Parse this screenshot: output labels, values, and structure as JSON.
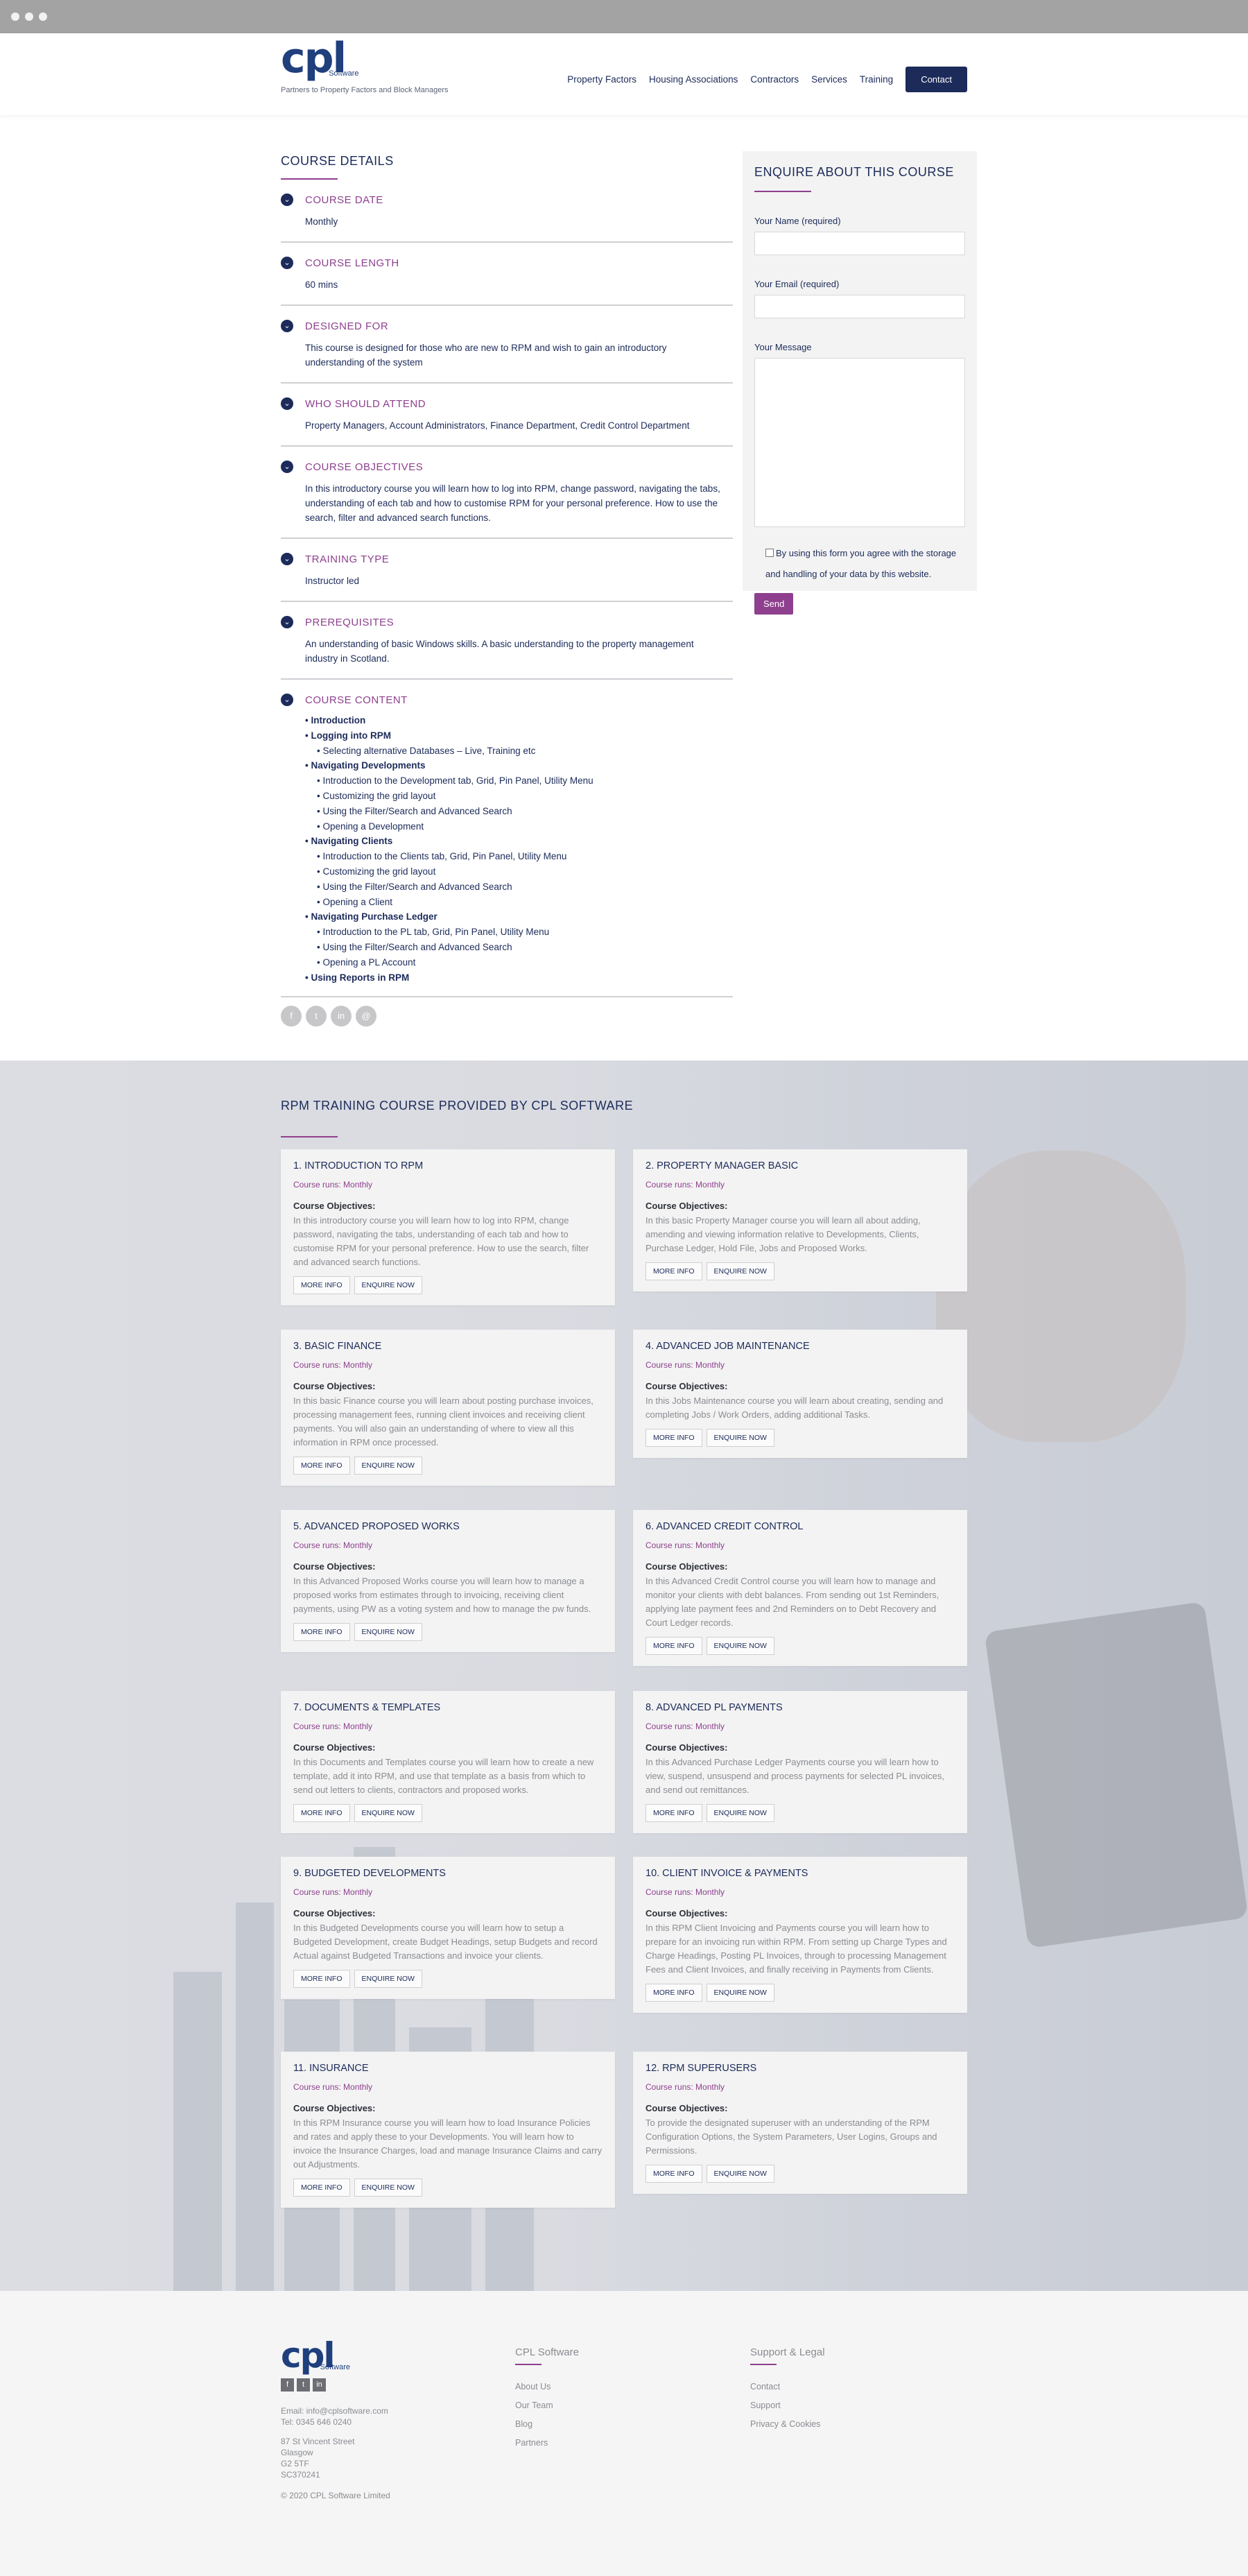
{
  "brand": {
    "logo_text": "cpl",
    "logo_sub": "Software",
    "tagline": "Partners to Property Factors and Block Managers"
  },
  "nav": {
    "items": [
      "Property Factors",
      "Housing Associations",
      "Contractors",
      "Services",
      "Training"
    ],
    "contact": "Contact"
  },
  "course_details": {
    "title": "COURSE DETAILS",
    "sections": [
      {
        "title": "COURSE DATE",
        "body": "Monthly"
      },
      {
        "title": "COURSE LENGTH",
        "body": "60 mins"
      },
      {
        "title": "DESIGNED FOR",
        "body": "This course is designed for those who are new to RPM and wish to gain an introductory understanding of the system"
      },
      {
        "title": "WHO SHOULD ATTEND",
        "body": "Property Managers, Account Administrators, Finance Department, Credit Control Department"
      },
      {
        "title": "COURSE OBJECTIVES",
        "body": "In this introductory course you will learn how to log into RPM, change password, navigating the tabs, understanding of each tab and how to customise RPM for your personal preference. How to use the search, filter and advanced search functions."
      },
      {
        "title": "TRAINING TYPE",
        "body": "Instructor led"
      },
      {
        "title": "PREREQUISITES",
        "body": "An understanding of basic Windows skills. A basic understanding to the property management industry in Scotland."
      },
      {
        "title": "COURSE CONTENT"
      }
    ],
    "content_items": [
      {
        "text": "Introduction",
        "level": 0
      },
      {
        "text": "Logging into RPM",
        "level": 0
      },
      {
        "text": "Selecting alternative Databases – Live, Training etc",
        "level": 1
      },
      {
        "text": "Navigating Developments",
        "level": 0
      },
      {
        "text": "Introduction to the Development tab, Grid, Pin Panel, Utility Menu",
        "level": 1
      },
      {
        "text": "Customizing the grid layout",
        "level": 1
      },
      {
        "text": "Using the Filter/Search and Advanced Search",
        "level": 1
      },
      {
        "text": "Opening a Development",
        "level": 1
      },
      {
        "text": "Navigating Clients",
        "level": 0
      },
      {
        "text": "Introduction to the Clients tab, Grid, Pin Panel, Utility Menu",
        "level": 1
      },
      {
        "text": "Customizing the grid layout",
        "level": 1
      },
      {
        "text": "Using the Filter/Search and Advanced Search",
        "level": 1
      },
      {
        "text": "Opening a Client",
        "level": 1
      },
      {
        "text": "Navigating Purchase Ledger",
        "level": 0
      },
      {
        "text": "Introduction to the PL tab, Grid, Pin Panel, Utility Menu",
        "level": 1
      },
      {
        "text": "Using the Filter/Search and Advanced Search",
        "level": 1
      },
      {
        "text": "Opening a PL Account",
        "level": 1
      },
      {
        "text": "Using Reports in RPM",
        "level": 0
      }
    ],
    "share_icons": [
      "f",
      "t",
      "in",
      "@"
    ]
  },
  "enquire": {
    "title": "ENQUIRE ABOUT THIS COURSE",
    "name_label": "Your Name (required)",
    "email_label": "Your Email (required)",
    "message_label": "Your Message",
    "consent": "By using this form you agree with the storage and handling of your data by this website.",
    "send": "Send"
  },
  "training": {
    "title": "RPM TRAINING COURSE PROVIDED BY CPL SOFTWARE",
    "runs_label": "Course runs: Monthly",
    "objectives_label": "Course Objectives:",
    "more_info": "MORE INFO",
    "enquire_now": "ENQUIRE NOW",
    "courses": [
      {
        "title": "1. INTRODUCTION TO RPM",
        "text": "In this introductory course you will learn how to log into RPM, change password, navigating the tabs, understanding of each tab and how to customise RPM for your personal preference. How to use the search, filter and advanced search functions."
      },
      {
        "title": "2. PROPERTY MANAGER BASIC",
        "text": "In this basic Property Manager course you will learn all about adding, amending and viewing information relative to Developments, Clients, Purchase Ledger, Hold File, Jobs and Proposed Works."
      },
      {
        "title": "3. BASIC FINANCE",
        "text": "In this basic Finance course you will learn about posting purchase invoices, processing management fees, running client invoices and receiving client payments. You will also gain an understanding of where to view all this information in RPM once processed."
      },
      {
        "title": "4. ADVANCED JOB MAINTENANCE",
        "text": "In this Jobs Maintenance course you will learn about creating, sending and completing Jobs / Work Orders, adding additional Tasks."
      },
      {
        "title": "5. ADVANCED PROPOSED WORKS",
        "text": "In this Advanced Proposed Works course you will learn how to manage a proposed works from estimates through to invoicing, receiving client payments, using PW as a voting system and how to manage the pw funds."
      },
      {
        "title": "6. ADVANCED CREDIT CONTROL",
        "text": "In this Advanced Credit Control course you will learn how to manage and monitor your clients with debt balances. From sending out 1st Reminders, applying late payment fees and 2nd Reminders on to Debt Recovery and Court Ledger records."
      },
      {
        "title": "7. DOCUMENTS & TEMPLATES",
        "text": "In this Documents and Templates course you will learn how to create a new template, add it into RPM, and use that template as a basis from which to send out letters to clients, contractors and proposed works."
      },
      {
        "title": "8. ADVANCED PL PAYMENTS",
        "text": "In this Advanced Purchase Ledger Payments course you will learn how to view, suspend, unsuspend and process payments for selected PL invoices, and send out remittances."
      },
      {
        "title": "9. BUDGETED DEVELOPMENTS",
        "text": "In this Budgeted Developments course you will learn how to setup a Budgeted Development, create Budget Headings, setup Budgets and record Actual against Budgeted Transactions and invoice your clients."
      },
      {
        "title": "10. CLIENT INVOICE & PAYMENTS",
        "text": "In this RPM Client Invoicing and Payments course you will learn how to prepare for an invoicing run within RPM. From setting up Charge Types and Charge Headings, Posting PL Invoices, through to processing Management Fees and Client Invoices, and finally receiving in Payments from Clients."
      },
      {
        "title": "11. INSURANCE",
        "text": "In this RPM Insurance course you will learn how to load Insurance Policies and rates and apply these to your Developments. You will learn how to invoice the Insurance Charges, load and manage Insurance Claims and carry out Adjustments."
      },
      {
        "title": "12. RPM SUPERUSERS",
        "text": "To provide the designated superuser with an understanding of the RPM Configuration Options, the System Parameters, User Logins, Groups and Permissions."
      }
    ]
  },
  "footer": {
    "email": "Email: info@cplsoftware.com",
    "tel": "Tel: 0345 646 0240",
    "address": [
      "87 St Vincent Street",
      "Glasgow",
      "G2 5TF",
      "SC370241"
    ],
    "copyright": "© 2020 CPL Software Limited",
    "social": [
      "f",
      "t",
      "in"
    ],
    "col1": {
      "title": "CPL Software",
      "links": [
        "About Us",
        "Our Team",
        "Blog",
        "Partners"
      ]
    },
    "col2": {
      "title": "Support & Legal",
      "links": [
        "Contact",
        "Support",
        "Privacy & Cookies"
      ]
    }
  },
  "colors": {
    "navy": "#1c2b5a",
    "purple": "#8e3f8e",
    "panel": "#f3f3f3"
  }
}
